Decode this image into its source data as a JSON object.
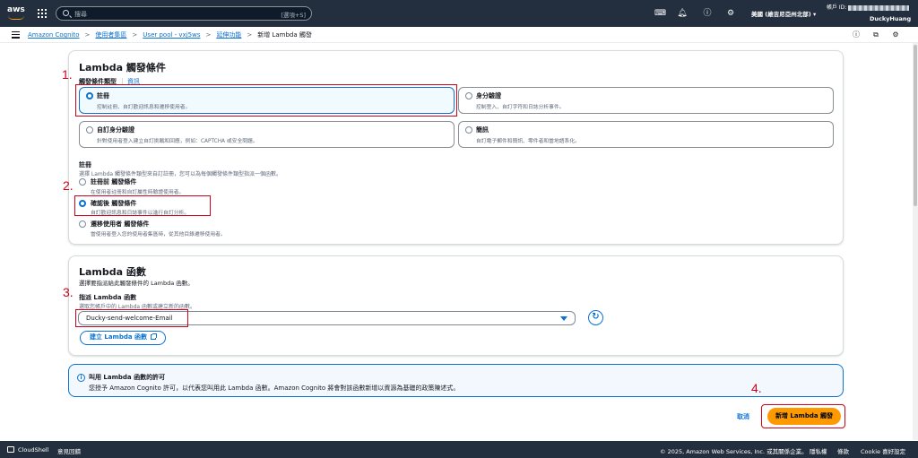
{
  "topnav": {
    "logo": "aws",
    "search_placeholder": "搜尋",
    "search_shortcut": "[選項+S]",
    "region": "美國 (維吉尼亞州北部)",
    "account_label": "帳戶 ID:",
    "user": "DuckyHuang",
    "icons": [
      "services-grid-icon",
      "search-icon",
      "terminal-icon",
      "bell-icon",
      "help-icon",
      "gear-icon"
    ]
  },
  "breadcrumb": {
    "items": [
      "Amazon Cognito",
      "使用者集區",
      "User pool - vxj5ws",
      "延伸功能"
    ],
    "current": "新增 Lambda 觸發"
  },
  "trigger_panel": {
    "title": "Lambda 觸發條件",
    "type_label": "觸發條件類型",
    "info": "資訊",
    "tiles": [
      {
        "title": "註冊",
        "desc": "控制註冊、自訂歡迎訊息和遷移使用者。",
        "selected": true
      },
      {
        "title": "身分驗證",
        "desc": "控制登入、自訂字符和日誌分析事件。",
        "selected": false
      },
      {
        "title": "自訂身分驗證",
        "desc": "針對使用者登入建立自訂挑戰和回應，例如：CAPTCHA 或安全問題。",
        "selected": false
      },
      {
        "title": "簡訊",
        "desc": "自訂電子郵件和簡訊、零件者和當地語系化。",
        "selected": false
      }
    ],
    "signup_label": "註冊",
    "signup_desc": "選擇 Lambda 觸發條件類型來自訂註冊，您可以為每個觸發條件類型指派一個函數。",
    "options": [
      {
        "title": "註冊前 觸發條件",
        "desc": "在使用者註冊和自訂屬性時驗證使用者。",
        "selected": false
      },
      {
        "title": "確認後 觸發條件",
        "desc": "自訂歡迎訊息和日誌事件以進行自訂分析。",
        "selected": true
      },
      {
        "title": "遷移使用者 觸發條件",
        "desc": "當使用者登入您的使用者集區時，從其他目錄遷移使用者。",
        "selected": false
      }
    ]
  },
  "lambda_panel": {
    "title": "Lambda 函數",
    "desc": "選擇要指派給此觸發條件的 Lambda 函數。",
    "assign_label": "指派 Lambda 函數",
    "assign_desc": "選取您帳戶中的 Lambda 函數或建立新的函數。",
    "selected_function": "Ducky-send-welcome-Email",
    "create_button": "建立 Lambda 函數"
  },
  "alert": {
    "title": "叫用 Lambda 函數的許可",
    "text": "您授予 Amazon Cognito 許可，以代表您叫用此 Lambda 函數。Amazon Cognito 將會對該函數新增以資源為基礎的政策陳述式。"
  },
  "actions": {
    "cancel": "取消",
    "submit": "新增 Lambda 觸發"
  },
  "annotations": [
    "1.",
    "2.",
    "3.",
    "4."
  ],
  "footer": {
    "cloudshell": "CloudShell",
    "feedback": "意見回饋",
    "copyright": "© 2025, Amazon Web Services, Inc. 或其關係企業。",
    "privacy": "隱私權",
    "terms": "條款",
    "cookie": "Cookie 喜好設定"
  },
  "colors": {
    "nav_bg": "#232f3e",
    "accent": "#0972d3",
    "primary": "#ff9900",
    "annotation": "#d0021b"
  }
}
